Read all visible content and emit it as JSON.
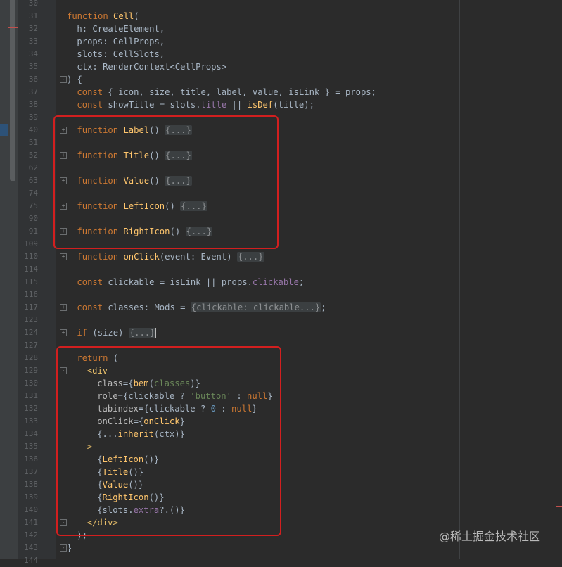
{
  "editor": {
    "lines": [
      {
        "n": "30",
        "indent": 0,
        "fold": "",
        "tokens": []
      },
      {
        "n": "31",
        "indent": 0,
        "fold": "",
        "tokens": [
          {
            "t": "function ",
            "c": "kw"
          },
          {
            "t": "Cell",
            "c": "fn"
          },
          {
            "t": "(",
            "c": ""
          }
        ]
      },
      {
        "n": "32",
        "indent": 2,
        "fold": "",
        "tokens": [
          {
            "t": "h: CreateElement,",
            "c": ""
          }
        ]
      },
      {
        "n": "33",
        "indent": 2,
        "fold": "",
        "tokens": [
          {
            "t": "props: CellProps,",
            "c": ""
          }
        ]
      },
      {
        "n": "34",
        "indent": 2,
        "fold": "",
        "tokens": [
          {
            "t": "slots: CellSlots,",
            "c": ""
          }
        ]
      },
      {
        "n": "35",
        "indent": 2,
        "fold": "",
        "tokens": [
          {
            "t": "ctx: RenderContext<CellProps>",
            "c": ""
          }
        ]
      },
      {
        "n": "36",
        "indent": 0,
        "fold": "-",
        "tokens": [
          {
            "t": ") {",
            "c": ""
          }
        ]
      },
      {
        "n": "37",
        "indent": 2,
        "fold": "",
        "tokens": [
          {
            "t": "const ",
            "c": "kw"
          },
          {
            "t": "{ icon, size, title, label, value, isLink } = props;",
            "c": ""
          }
        ]
      },
      {
        "n": "38",
        "indent": 2,
        "fold": "",
        "tokens": [
          {
            "t": "const ",
            "c": "kw"
          },
          {
            "t": "showTitle = slots.",
            "c": ""
          },
          {
            "t": "title",
            "c": "prop"
          },
          {
            "t": " || ",
            "c": ""
          },
          {
            "t": "isDef",
            "c": "fn"
          },
          {
            "t": "(title);",
            "c": ""
          }
        ]
      },
      {
        "n": "39",
        "indent": 0,
        "fold": "",
        "tokens": []
      },
      {
        "n": "40",
        "indent": 2,
        "fold": "+",
        "tokens": [
          {
            "t": "function ",
            "c": "kw"
          },
          {
            "t": "Label",
            "c": "fn"
          },
          {
            "t": "() ",
            "c": ""
          },
          {
            "t": "{...}",
            "c": "folded"
          }
        ]
      },
      {
        "n": "51",
        "indent": 0,
        "fold": "",
        "tokens": []
      },
      {
        "n": "52",
        "indent": 2,
        "fold": "+",
        "tokens": [
          {
            "t": "function ",
            "c": "kw"
          },
          {
            "t": "Title",
            "c": "fn"
          },
          {
            "t": "() ",
            "c": ""
          },
          {
            "t": "{...}",
            "c": "folded"
          }
        ]
      },
      {
        "n": "62",
        "indent": 0,
        "fold": "",
        "tokens": []
      },
      {
        "n": "63",
        "indent": 2,
        "fold": "+",
        "tokens": [
          {
            "t": "function ",
            "c": "kw"
          },
          {
            "t": "Value",
            "c": "fn"
          },
          {
            "t": "() ",
            "c": ""
          },
          {
            "t": "{...}",
            "c": "folded"
          }
        ]
      },
      {
        "n": "74",
        "indent": 0,
        "fold": "",
        "tokens": []
      },
      {
        "n": "75",
        "indent": 2,
        "fold": "+",
        "tokens": [
          {
            "t": "function ",
            "c": "kw"
          },
          {
            "t": "LeftIcon",
            "c": "fn"
          },
          {
            "t": "() ",
            "c": ""
          },
          {
            "t": "{...}",
            "c": "folded"
          }
        ]
      },
      {
        "n": "90",
        "indent": 0,
        "fold": "",
        "tokens": []
      },
      {
        "n": "91",
        "indent": 2,
        "fold": "+",
        "tokens": [
          {
            "t": "function ",
            "c": "kw"
          },
          {
            "t": "RightIcon",
            "c": "fn"
          },
          {
            "t": "() ",
            "c": ""
          },
          {
            "t": "{...}",
            "c": "folded"
          }
        ]
      },
      {
        "n": "109",
        "indent": 0,
        "fold": "",
        "tokens": []
      },
      {
        "n": "110",
        "indent": 2,
        "fold": "+",
        "tokens": [
          {
            "t": "function ",
            "c": "kw"
          },
          {
            "t": "onClick",
            "c": "fn"
          },
          {
            "t": "(event: Event) ",
            "c": ""
          },
          {
            "t": "{...}",
            "c": "folded"
          }
        ]
      },
      {
        "n": "114",
        "indent": 0,
        "fold": "",
        "tokens": []
      },
      {
        "n": "115",
        "indent": 2,
        "fold": "",
        "tokens": [
          {
            "t": "const ",
            "c": "kw"
          },
          {
            "t": "clickable = isLink || props.",
            "c": ""
          },
          {
            "t": "clickable",
            "c": "prop"
          },
          {
            "t": ";",
            "c": ""
          }
        ]
      },
      {
        "n": "116",
        "indent": 0,
        "fold": "",
        "tokens": []
      },
      {
        "n": "117",
        "indent": 2,
        "fold": "+",
        "tokens": [
          {
            "t": "const ",
            "c": "kw"
          },
          {
            "t": "classes: Mods = ",
            "c": ""
          },
          {
            "t": "{clickable: clickable...}",
            "c": "folded"
          },
          {
            "t": ";",
            "c": ""
          }
        ]
      },
      {
        "n": "123",
        "indent": 0,
        "fold": "",
        "tokens": []
      },
      {
        "n": "124",
        "indent": 2,
        "fold": "+",
        "tokens": [
          {
            "t": "if ",
            "c": "kw"
          },
          {
            "t": "(size) ",
            "c": ""
          },
          {
            "t": "{...}",
            "c": "folded"
          },
          {
            "t": "|",
            "c": "caret"
          }
        ]
      },
      {
        "n": "127",
        "indent": 0,
        "fold": "",
        "tokens": []
      },
      {
        "n": "128",
        "indent": 2,
        "fold": "",
        "tokens": [
          {
            "t": "return ",
            "c": "kw"
          },
          {
            "t": "(",
            "c": ""
          }
        ]
      },
      {
        "n": "129",
        "indent": 4,
        "fold": "-",
        "tokens": [
          {
            "t": "<div",
            "c": "tag"
          }
        ]
      },
      {
        "n": "130",
        "indent": 6,
        "fold": "",
        "tokens": [
          {
            "t": "class",
            "c": "attr"
          },
          {
            "t": "={",
            "c": ""
          },
          {
            "t": "bem",
            "c": "fn"
          },
          {
            "t": "(",
            "c": ""
          },
          {
            "t": "classes",
            "c": "str"
          },
          {
            "t": ")}",
            "c": ""
          }
        ]
      },
      {
        "n": "131",
        "indent": 6,
        "fold": "",
        "tokens": [
          {
            "t": "role",
            "c": "attr"
          },
          {
            "t": "={clickable ? ",
            "c": ""
          },
          {
            "t": "'button'",
            "c": "str"
          },
          {
            "t": " : ",
            "c": ""
          },
          {
            "t": "null",
            "c": "kw"
          },
          {
            "t": "}",
            "c": ""
          }
        ]
      },
      {
        "n": "132",
        "indent": 6,
        "fold": "",
        "tokens": [
          {
            "t": "tabindex",
            "c": "attr"
          },
          {
            "t": "={clickable ? ",
            "c": ""
          },
          {
            "t": "0",
            "c": "num"
          },
          {
            "t": " : ",
            "c": ""
          },
          {
            "t": "null",
            "c": "kw"
          },
          {
            "t": "}",
            "c": ""
          }
        ]
      },
      {
        "n": "133",
        "indent": 6,
        "fold": "",
        "tokens": [
          {
            "t": "onClick",
            "c": "attr"
          },
          {
            "t": "={",
            "c": ""
          },
          {
            "t": "onClick",
            "c": "fn"
          },
          {
            "t": "}",
            "c": ""
          }
        ]
      },
      {
        "n": "134",
        "indent": 6,
        "fold": "",
        "tokens": [
          {
            "t": "{...",
            "c": ""
          },
          {
            "t": "inherit",
            "c": "fn"
          },
          {
            "t": "(ctx)}",
            "c": ""
          }
        ]
      },
      {
        "n": "135",
        "indent": 4,
        "fold": "",
        "tokens": [
          {
            "t": ">",
            "c": "tag"
          }
        ]
      },
      {
        "n": "136",
        "indent": 6,
        "fold": "",
        "tokens": [
          {
            "t": "{",
            "c": ""
          },
          {
            "t": "LeftIcon",
            "c": "fn"
          },
          {
            "t": "()}",
            "c": ""
          }
        ]
      },
      {
        "n": "137",
        "indent": 6,
        "fold": "",
        "tokens": [
          {
            "t": "{",
            "c": ""
          },
          {
            "t": "Title",
            "c": "fn"
          },
          {
            "t": "()}",
            "c": ""
          }
        ]
      },
      {
        "n": "138",
        "indent": 6,
        "fold": "",
        "tokens": [
          {
            "t": "{",
            "c": ""
          },
          {
            "t": "Value",
            "c": "fn"
          },
          {
            "t": "()}",
            "c": ""
          }
        ]
      },
      {
        "n": "139",
        "indent": 6,
        "fold": "",
        "tokens": [
          {
            "t": "{",
            "c": ""
          },
          {
            "t": "RightIcon",
            "c": "fn"
          },
          {
            "t": "()}",
            "c": ""
          }
        ]
      },
      {
        "n": "140",
        "indent": 6,
        "fold": "",
        "tokens": [
          {
            "t": "{slots.",
            "c": ""
          },
          {
            "t": "extra",
            "c": "prop"
          },
          {
            "t": "?.()}",
            "c": ""
          }
        ]
      },
      {
        "n": "141",
        "indent": 4,
        "fold": "-",
        "tokens": [
          {
            "t": "</div>",
            "c": "tag"
          }
        ]
      },
      {
        "n": "142",
        "indent": 2,
        "fold": "",
        "tokens": [
          {
            "t": ");",
            "c": ""
          }
        ]
      },
      {
        "n": "143",
        "indent": 0,
        "fold": "-",
        "tokens": [
          {
            "t": "}",
            "c": ""
          }
        ]
      },
      {
        "n": "144",
        "indent": 0,
        "fold": "",
        "tokens": []
      }
    ]
  },
  "watermark": {
    "text": "@稀土掘金技术社区"
  },
  "colors": {
    "background": "#2b2b2b",
    "gutter": "#313335",
    "keyword": "#cc7832",
    "function": "#ffc66d",
    "property": "#9876aa",
    "string": "#6a8759",
    "number": "#6897bb",
    "highlight_box": "#d21f1f"
  }
}
